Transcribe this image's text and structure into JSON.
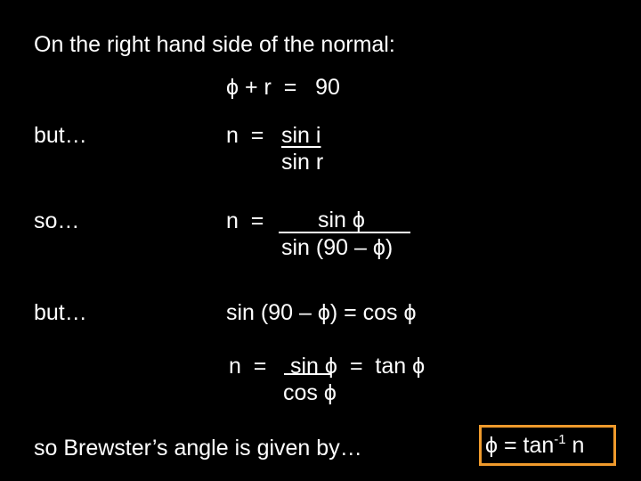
{
  "slide": {
    "title": "On the right hand side of the normal:",
    "eq_sum": "ϕ + r  =   90",
    "row1": {
      "lead": "but…",
      "lhs": "n  = ",
      "numerator": "sin i",
      "denominator": "sin r"
    },
    "row2": {
      "lead": "so…",
      "lhs": "n  = ",
      "numerator": "sin ϕ",
      "denominator": "sin (90 – ϕ)"
    },
    "row3": {
      "lead": "but…",
      "identity": "sin (90 – ϕ) = cos ϕ"
    },
    "row4": {
      "lhs": "n  = ",
      "numerator": " sin ϕ",
      "rhs": " =  tan ϕ",
      "denominator": "cos ϕ"
    },
    "conclusion": "so Brewster’s angle is given by…",
    "result": {
      "prefix": "ϕ = tan",
      "exponent": "-1",
      "suffix": " n",
      "border_color": "#ef9a2c"
    }
  }
}
